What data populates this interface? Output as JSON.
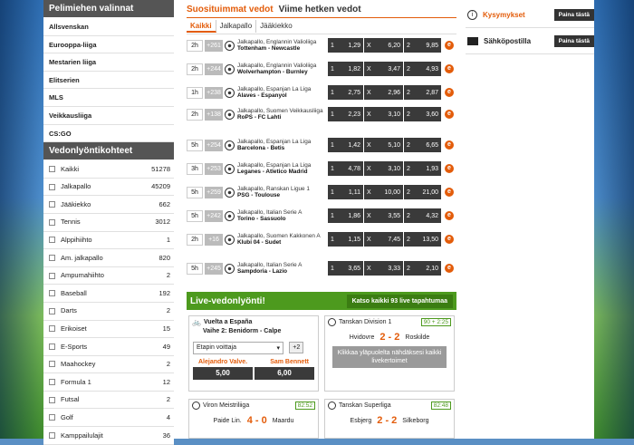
{
  "sidebar": {
    "choices_title": "Pelimiehen valinnat",
    "choices": [
      "Allsvenskan",
      "Eurooppa-liiga",
      "Mestarien liiga",
      "Elitserien",
      "MLS",
      "Veikkausliiga",
      "CS:GO"
    ],
    "targets_title": "Vedonlyöntikohteet",
    "targets": [
      {
        "name": "Kaikki",
        "count": "51278"
      },
      {
        "name": "Jalkapallo",
        "count": "45209"
      },
      {
        "name": "Jääkiekko",
        "count": "662"
      },
      {
        "name": "Tennis",
        "count": "3012"
      },
      {
        "name": "Alppihiihto",
        "count": "1"
      },
      {
        "name": "Am. jalkapallo",
        "count": "820"
      },
      {
        "name": "Ampumahiihto",
        "count": "2"
      },
      {
        "name": "Baseball",
        "count": "192"
      },
      {
        "name": "Darts",
        "count": "2"
      },
      {
        "name": "Erikoiset",
        "count": "15"
      },
      {
        "name": "E-Sports",
        "count": "49"
      },
      {
        "name": "Maahockey",
        "count": "2"
      },
      {
        "name": "Formula 1",
        "count": "12"
      },
      {
        "name": "Futsal",
        "count": "2"
      },
      {
        "name": "Golf",
        "count": "4"
      },
      {
        "name": "Kamppailulajit",
        "count": "36"
      }
    ]
  },
  "center": {
    "tab_popular": "Suosituimmat vedot",
    "tab_now": "Viime hetken vedot",
    "subtabs": [
      "Kaikki",
      "Jalkapallo",
      "Jääkiekko"
    ],
    "rows": [
      {
        "time": "2h",
        "plus": "+261",
        "league": "Jalkapallo, Englannin Valioliiga",
        "teams": "Tottenham - Newcastle",
        "o1": "1,29",
        "ox": "6,20",
        "o2": "9,85"
      },
      {
        "time": "2h",
        "plus": "+244",
        "league": "Jalkapallo, Englannin Valioliiga",
        "teams": "Wolverhampton - Burnley",
        "o1": "1,82",
        "ox": "3,47",
        "o2": "4,93"
      },
      {
        "time": "1h",
        "plus": "+238",
        "league": "Jalkapallo, Espanjan La Liga",
        "teams": "Alaves - Espanyol",
        "o1": "2,75",
        "ox": "2,96",
        "o2": "2,87"
      },
      {
        "time": "2h",
        "plus": "+138",
        "league": "Jalkapallo, Suomen Veikkausliiga",
        "teams": "RoPS - FC Lahti",
        "o1": "2,23",
        "ox": "3,10",
        "o2": "3,60"
      },
      {
        "time": "5h",
        "plus": "+254",
        "league": "Jalkapallo, Espanjan La Liga",
        "teams": "Barcelona - Betis",
        "o1": "1,42",
        "ox": "5,10",
        "o2": "6,65"
      },
      {
        "time": "3h",
        "plus": "+253",
        "league": "Jalkapallo, Espanjan La Liga",
        "teams": "Leganes - Atletico Madrid",
        "o1": "4,78",
        "ox": "3,10",
        "o2": "1,93"
      },
      {
        "time": "5h",
        "plus": "+259",
        "league": "Jalkapallo, Ranskan Ligue 1",
        "teams": "PSG - Toulouse",
        "o1": "1,11",
        "ox": "10,00",
        "o2": "21,00"
      },
      {
        "time": "5h",
        "plus": "+242",
        "league": "Jalkapallo, Italian Serie A",
        "teams": "Torino - Sassuolo",
        "o1": "1,86",
        "ox": "3,55",
        "o2": "4,32"
      },
      {
        "time": "2h",
        "plus": "+16",
        "league": "Jalkapallo, Suomen Kakkonen A",
        "teams": "Klubi 04 - Sudet",
        "o1": "1,15",
        "ox": "7,45",
        "o2": "13,50"
      },
      {
        "time": "5h",
        "plus": "+245",
        "league": "Jalkapallo, Italian Serie A",
        "teams": "Sampdoria - Lazio",
        "o1": "3,65",
        "ox": "3,33",
        "o2": "2,10"
      }
    ],
    "live_title": "Live-vedonlyönti!",
    "live_button": "Katso kaikki 93 live tapahtumaa",
    "cards": {
      "c1": {
        "title": "Vuelta a España",
        "sub": "Vaihe 2: Benidorm - Calpe",
        "select": "Etapin voittaja",
        "plus": "+2",
        "r1": "Alejandro Valve.",
        "r2": "Sam Bennett",
        "p1": "5,00",
        "p2": "6,00"
      },
      "c2": {
        "title": "Tanskan Division 1",
        "time": "90 + 2:25",
        "home": "Hvidovre",
        "score": "2 - 2",
        "away": "Roskilde",
        "msg": "Klikkaa yläpuolelta nähdäksesi kaikki livekertoimet"
      },
      "c3": {
        "title": "Viron Meistriliiga",
        "time": "82:52",
        "home": "Paide Lin.",
        "score": "4 - 0",
        "away": "Maardu"
      },
      "c4": {
        "title": "Tanskan Superliga",
        "time": "82:48",
        "home": "Esbjerg",
        "score": "2 - 2",
        "away": "Silkeborg"
      }
    }
  },
  "right": {
    "faq_label": "Kysymykset",
    "faq_btn": "Paina tästä",
    "mail_label": "Sähköpostilla",
    "mail_btn": "Paina tästä"
  },
  "colors": {
    "accent": "#e35c0a",
    "live": "#4d9a1e",
    "dark": "#3a3a3a"
  }
}
